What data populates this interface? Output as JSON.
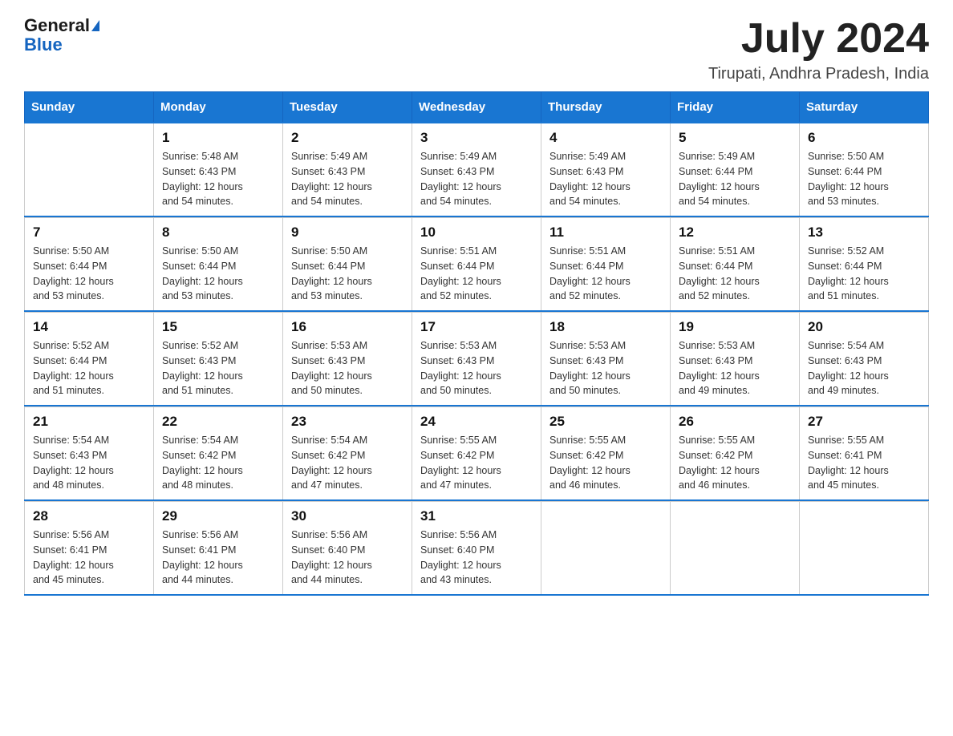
{
  "header": {
    "logo_general": "General",
    "logo_blue": "Blue",
    "month_title": "July 2024",
    "location": "Tirupati, Andhra Pradesh, India"
  },
  "weekdays": [
    "Sunday",
    "Monday",
    "Tuesday",
    "Wednesday",
    "Thursday",
    "Friday",
    "Saturday"
  ],
  "weeks": [
    [
      {
        "day": "",
        "info": ""
      },
      {
        "day": "1",
        "info": "Sunrise: 5:48 AM\nSunset: 6:43 PM\nDaylight: 12 hours\nand 54 minutes."
      },
      {
        "day": "2",
        "info": "Sunrise: 5:49 AM\nSunset: 6:43 PM\nDaylight: 12 hours\nand 54 minutes."
      },
      {
        "day": "3",
        "info": "Sunrise: 5:49 AM\nSunset: 6:43 PM\nDaylight: 12 hours\nand 54 minutes."
      },
      {
        "day": "4",
        "info": "Sunrise: 5:49 AM\nSunset: 6:43 PM\nDaylight: 12 hours\nand 54 minutes."
      },
      {
        "day": "5",
        "info": "Sunrise: 5:49 AM\nSunset: 6:44 PM\nDaylight: 12 hours\nand 54 minutes."
      },
      {
        "day": "6",
        "info": "Sunrise: 5:50 AM\nSunset: 6:44 PM\nDaylight: 12 hours\nand 53 minutes."
      }
    ],
    [
      {
        "day": "7",
        "info": "Sunrise: 5:50 AM\nSunset: 6:44 PM\nDaylight: 12 hours\nand 53 minutes."
      },
      {
        "day": "8",
        "info": "Sunrise: 5:50 AM\nSunset: 6:44 PM\nDaylight: 12 hours\nand 53 minutes."
      },
      {
        "day": "9",
        "info": "Sunrise: 5:50 AM\nSunset: 6:44 PM\nDaylight: 12 hours\nand 53 minutes."
      },
      {
        "day": "10",
        "info": "Sunrise: 5:51 AM\nSunset: 6:44 PM\nDaylight: 12 hours\nand 52 minutes."
      },
      {
        "day": "11",
        "info": "Sunrise: 5:51 AM\nSunset: 6:44 PM\nDaylight: 12 hours\nand 52 minutes."
      },
      {
        "day": "12",
        "info": "Sunrise: 5:51 AM\nSunset: 6:44 PM\nDaylight: 12 hours\nand 52 minutes."
      },
      {
        "day": "13",
        "info": "Sunrise: 5:52 AM\nSunset: 6:44 PM\nDaylight: 12 hours\nand 51 minutes."
      }
    ],
    [
      {
        "day": "14",
        "info": "Sunrise: 5:52 AM\nSunset: 6:44 PM\nDaylight: 12 hours\nand 51 minutes."
      },
      {
        "day": "15",
        "info": "Sunrise: 5:52 AM\nSunset: 6:43 PM\nDaylight: 12 hours\nand 51 minutes."
      },
      {
        "day": "16",
        "info": "Sunrise: 5:53 AM\nSunset: 6:43 PM\nDaylight: 12 hours\nand 50 minutes."
      },
      {
        "day": "17",
        "info": "Sunrise: 5:53 AM\nSunset: 6:43 PM\nDaylight: 12 hours\nand 50 minutes."
      },
      {
        "day": "18",
        "info": "Sunrise: 5:53 AM\nSunset: 6:43 PM\nDaylight: 12 hours\nand 50 minutes."
      },
      {
        "day": "19",
        "info": "Sunrise: 5:53 AM\nSunset: 6:43 PM\nDaylight: 12 hours\nand 49 minutes."
      },
      {
        "day": "20",
        "info": "Sunrise: 5:54 AM\nSunset: 6:43 PM\nDaylight: 12 hours\nand 49 minutes."
      }
    ],
    [
      {
        "day": "21",
        "info": "Sunrise: 5:54 AM\nSunset: 6:43 PM\nDaylight: 12 hours\nand 48 minutes."
      },
      {
        "day": "22",
        "info": "Sunrise: 5:54 AM\nSunset: 6:42 PM\nDaylight: 12 hours\nand 48 minutes."
      },
      {
        "day": "23",
        "info": "Sunrise: 5:54 AM\nSunset: 6:42 PM\nDaylight: 12 hours\nand 47 minutes."
      },
      {
        "day": "24",
        "info": "Sunrise: 5:55 AM\nSunset: 6:42 PM\nDaylight: 12 hours\nand 47 minutes."
      },
      {
        "day": "25",
        "info": "Sunrise: 5:55 AM\nSunset: 6:42 PM\nDaylight: 12 hours\nand 46 minutes."
      },
      {
        "day": "26",
        "info": "Sunrise: 5:55 AM\nSunset: 6:42 PM\nDaylight: 12 hours\nand 46 minutes."
      },
      {
        "day": "27",
        "info": "Sunrise: 5:55 AM\nSunset: 6:41 PM\nDaylight: 12 hours\nand 45 minutes."
      }
    ],
    [
      {
        "day": "28",
        "info": "Sunrise: 5:56 AM\nSunset: 6:41 PM\nDaylight: 12 hours\nand 45 minutes."
      },
      {
        "day": "29",
        "info": "Sunrise: 5:56 AM\nSunset: 6:41 PM\nDaylight: 12 hours\nand 44 minutes."
      },
      {
        "day": "30",
        "info": "Sunrise: 5:56 AM\nSunset: 6:40 PM\nDaylight: 12 hours\nand 44 minutes."
      },
      {
        "day": "31",
        "info": "Sunrise: 5:56 AM\nSunset: 6:40 PM\nDaylight: 12 hours\nand 43 minutes."
      },
      {
        "day": "",
        "info": ""
      },
      {
        "day": "",
        "info": ""
      },
      {
        "day": "",
        "info": ""
      }
    ]
  ]
}
